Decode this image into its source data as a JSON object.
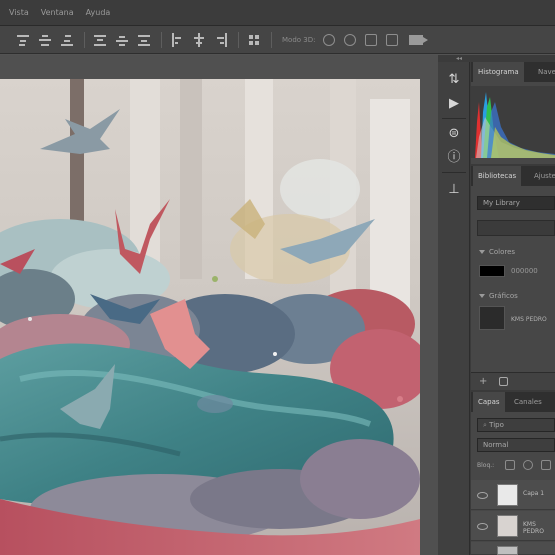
{
  "menu": {
    "items": [
      "Vista",
      "Ventana",
      "Ayuda"
    ]
  },
  "optionsbar": {
    "mode3d_label": "Modo 3D:"
  },
  "panels": {
    "histogram_tabs": [
      "Histograma",
      "Navegador"
    ],
    "library_tabs": [
      "Bibliotecas",
      "Ajustes"
    ],
    "library_select": "My Library",
    "colors_label": "Colores",
    "color_hex": "000000",
    "graphics_label": "Gráficos",
    "graphic_name": "KMS PEDRO",
    "layers_tabs": [
      "Capas",
      "Canales"
    ],
    "kind_filter": "Tipo",
    "blend_mode": "Normal",
    "lock_label": "Bloq.:",
    "layers": [
      {
        "name": "Capa 1"
      },
      {
        "name": "KMS PEDRO"
      }
    ]
  },
  "colors": {
    "menubar": "#3c3c3c",
    "optionsbar": "#454545",
    "panel_bg": "#3a3a3a",
    "workspace": "#505050"
  }
}
